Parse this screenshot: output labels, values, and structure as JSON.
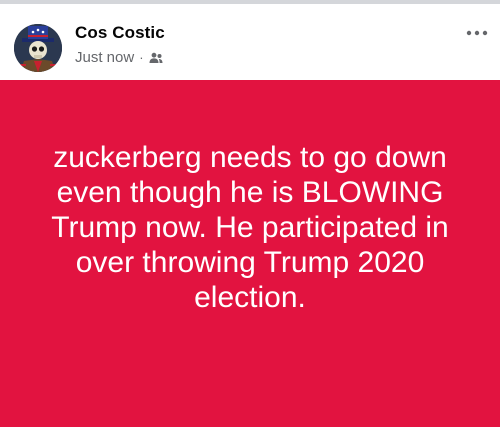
{
  "post": {
    "author": "Cos Costic",
    "timestamp": "Just now",
    "separator": "·",
    "audience_icon": "friends-icon",
    "more_icon": "ellipsis-icon",
    "text": "zuckerberg needs to go down even though he is BLOWING Trump now. He participated in over throwing Trump 2020 election.",
    "background_color": "#e21340",
    "text_color": "#ffffff"
  }
}
